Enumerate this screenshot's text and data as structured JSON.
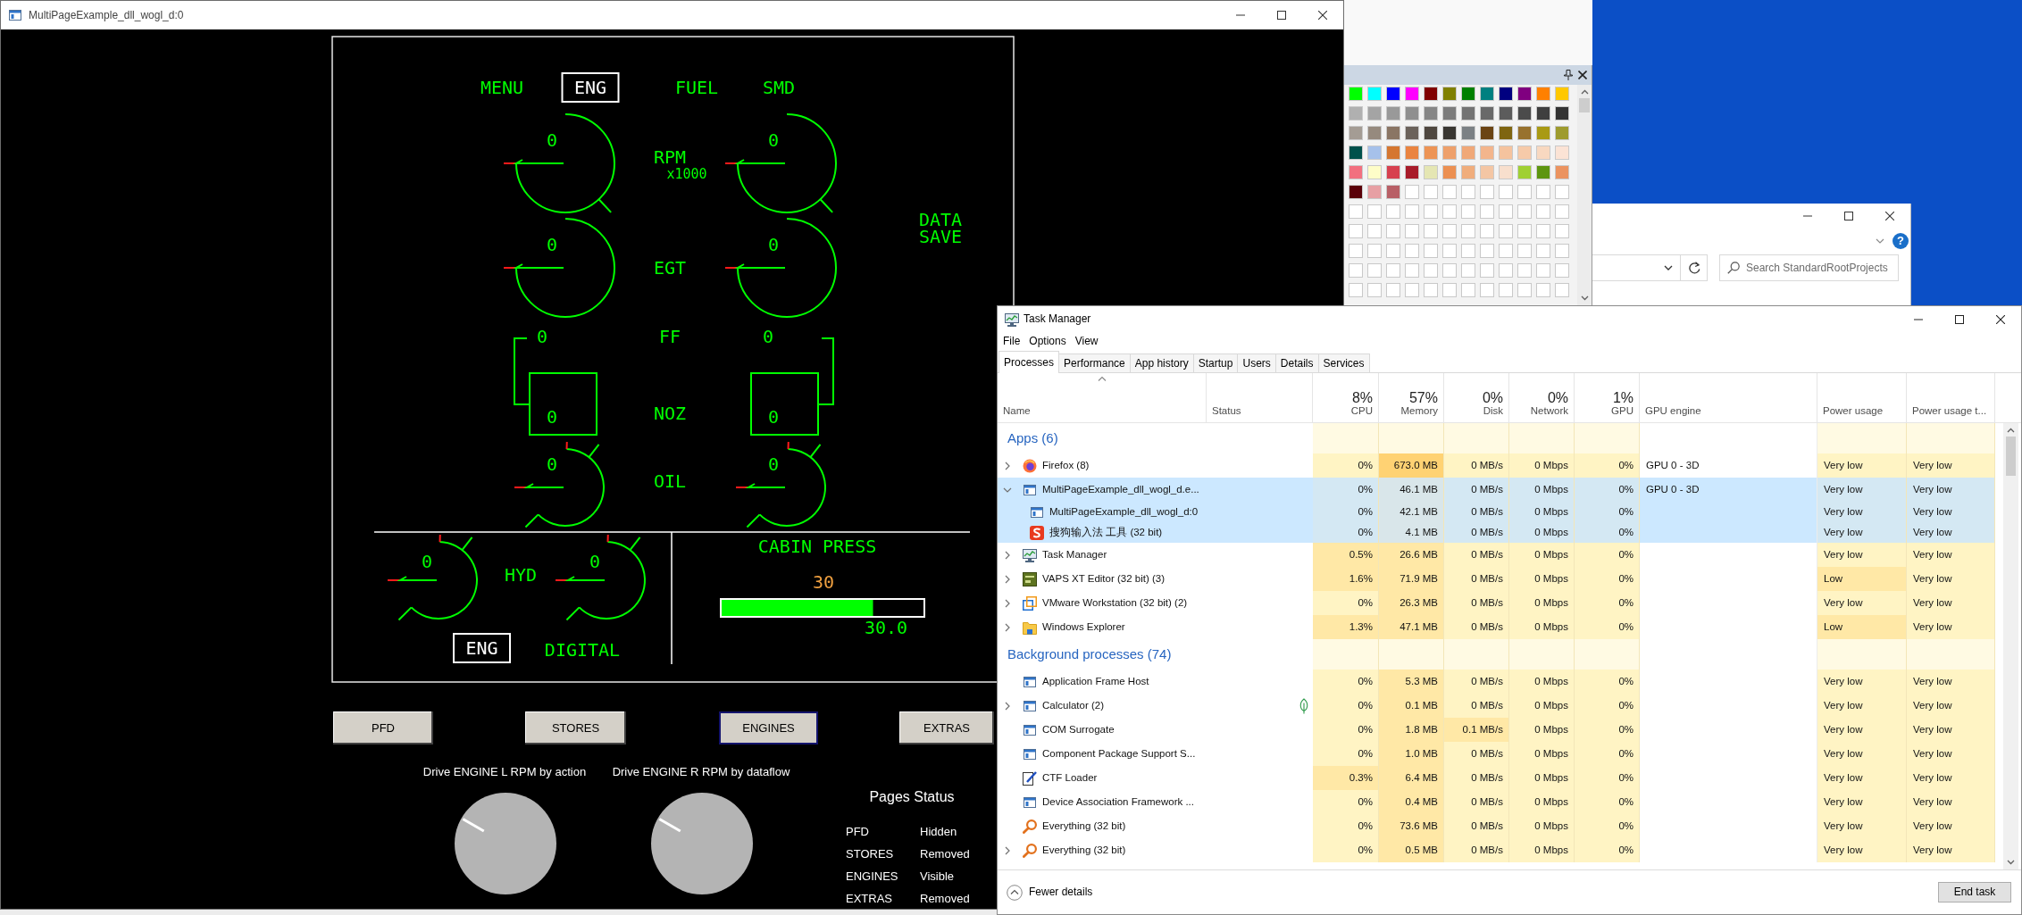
{
  "app_window": {
    "title": "MultiPageExample_dll_wogl_d:0",
    "engine_display": {
      "menu": [
        {
          "label": "MENU",
          "selected": false
        },
        {
          "label": "ENG",
          "selected": true
        },
        {
          "label": "FUEL",
          "selected": false
        },
        {
          "label": "SMD",
          "selected": false
        }
      ],
      "data_save": "DATA SAVE",
      "gauges": [
        {
          "kind": "dial",
          "label": "RPM",
          "sublabel": "x1000",
          "left": {
            "value": "0"
          },
          "right": {
            "value": "0"
          }
        },
        {
          "kind": "dial",
          "label": "EGT",
          "left": {
            "value": "0"
          },
          "right": {
            "value": "0"
          }
        },
        {
          "kind": "bracket",
          "label": "FF",
          "left": {
            "value": "0"
          },
          "right": {
            "value": "0"
          }
        },
        {
          "kind": "box",
          "label": "NOZ",
          "left": {
            "value": "0"
          },
          "right": {
            "value": "0"
          }
        },
        {
          "kind": "small_dial",
          "label": "OIL",
          "left": {
            "value": "0"
          },
          "right": {
            "value": "0"
          }
        }
      ],
      "hydraulics": {
        "label": "HYD",
        "left": {
          "value": "0"
        },
        "right": {
          "value": "0"
        }
      },
      "mode_button": "ENG",
      "mode_label": "DIGITAL",
      "cabin_press": {
        "title": "CABIN PRESS",
        "setpoint": "30",
        "level": 0.75,
        "reading": "30.0"
      }
    },
    "page_buttons": [
      {
        "label": "PFD",
        "selected": false
      },
      {
        "label": "STORES",
        "selected": false
      },
      {
        "label": "ENGINES",
        "selected": true
      },
      {
        "label": "EXTRAS",
        "selected": false
      }
    ],
    "knobs": [
      {
        "caption": "Drive ENGINE L RPM by action"
      },
      {
        "caption": "Drive ENGINE R RPM by dataflow"
      }
    ],
    "pages_status": {
      "title": "Pages Status",
      "rows": [
        {
          "page": "PFD",
          "status": "Hidden"
        },
        {
          "page": "STORES",
          "status": "Removed"
        },
        {
          "page": "ENGINES",
          "status": "Visible"
        },
        {
          "page": "EXTRAS",
          "status": "Removed"
        }
      ]
    }
  },
  "palette": {
    "swatches": [
      {
        "color": "#00ff00"
      },
      {
        "color": "#00ffff"
      },
      {
        "color": "#0000ff"
      },
      {
        "color": "#ff00ff"
      },
      {
        "color": "#800000"
      },
      {
        "color": "#808000"
      },
      {
        "color": "#008000"
      },
      {
        "color": "#008080"
      },
      {
        "color": "#000080"
      },
      {
        "color": "#800080"
      },
      {
        "color": "#ff8000"
      },
      {
        "color": "#ffc800"
      },
      {
        "color": "#b0b0b0"
      },
      {
        "color": "#a4a4a4"
      },
      {
        "color": "#999999"
      },
      {
        "color": "#8f8f8f"
      },
      {
        "color": "#868686"
      },
      {
        "color": "#7c7c7c"
      },
      {
        "color": "#737373"
      },
      {
        "color": "#696969"
      },
      {
        "color": "#5c5c5c"
      },
      {
        "color": "#4b4b4b"
      },
      {
        "color": "#3f3f3f"
      },
      {
        "color": "#333333"
      },
      {
        "color": "#a49c94"
      },
      {
        "color": "#968a7e"
      },
      {
        "color": "#8a7564"
      },
      {
        "color": "#6b625b"
      },
      {
        "color": "#4f4740"
      },
      {
        "color": "#393632"
      },
      {
        "color": "#7b8084"
      },
      {
        "color": "#6b4414"
      },
      {
        "color": "#7f6511"
      },
      {
        "color": "#98722e"
      },
      {
        "color": "#a99a14"
      },
      {
        "color": "#9e9b2e"
      },
      {
        "color": "#00514b"
      },
      {
        "color": "#a6c1ea"
      },
      {
        "color": "#d57630"
      },
      {
        "color": "#ea8441"
      },
      {
        "color": "#ed9455"
      },
      {
        "color": "#eea06b"
      },
      {
        "color": "#f0a878"
      },
      {
        "color": "#f3b58c"
      },
      {
        "color": "#f5c39e"
      },
      {
        "color": "#f6caa9"
      },
      {
        "color": "#f8d8c0"
      },
      {
        "color": "#fbe3d5"
      },
      {
        "color": "#f2707f"
      },
      {
        "color": "#fefdc8"
      },
      {
        "color": "#d7404f"
      },
      {
        "color": "#a81b29"
      },
      {
        "color": "#e5e6b3"
      },
      {
        "color": "#ec9052"
      },
      {
        "color": "#f0ad7c"
      },
      {
        "color": "#f4c6a4"
      },
      {
        "color": "#f8dfcd"
      },
      {
        "color": "#a0d033"
      },
      {
        "color": "#5d9510"
      },
      {
        "color": "#eb9360"
      },
      {
        "color": "#5a0008"
      },
      {
        "color": "#e7a0a4"
      },
      {
        "color": "#b85f66"
      },
      {
        "color": "#ffffff"
      },
      {
        "color": "#ffffff"
      },
      {
        "color": "#ffffff"
      },
      {
        "color": "#ffffff"
      },
      {
        "color": "#ffffff"
      },
      {
        "color": "#ffffff"
      },
      {
        "color": "#ffffff"
      },
      {
        "color": "#ffffff"
      },
      {
        "color": "#ffffff"
      },
      {
        "color": "#ffffff"
      },
      {
        "color": "#ffffff"
      },
      {
        "color": "#ffffff"
      },
      {
        "color": "#ffffff"
      },
      {
        "color": "#ffffff"
      },
      {
        "color": "#ffffff"
      },
      {
        "color": "#ffffff"
      },
      {
        "color": "#ffffff"
      },
      {
        "color": "#ffffff"
      },
      {
        "color": "#ffffff"
      },
      {
        "color": "#ffffff"
      },
      {
        "color": "#ffffff"
      },
      {
        "color": "#ffffff"
      },
      {
        "color": "#ffffff"
      },
      {
        "color": "#ffffff"
      },
      {
        "color": "#ffffff"
      },
      {
        "color": "#ffffff"
      },
      {
        "color": "#ffffff"
      },
      {
        "color": "#ffffff"
      },
      {
        "color": "#ffffff"
      },
      {
        "color": "#ffffff"
      },
      {
        "color": "#ffffff"
      },
      {
        "color": "#ffffff"
      },
      {
        "color": "#ffffff"
      },
      {
        "color": "#ffffff"
      },
      {
        "color": "#ffffff"
      },
      {
        "color": "#ffffff"
      },
      {
        "color": "#ffffff"
      },
      {
        "color": "#ffffff"
      },
      {
        "color": "#ffffff"
      },
      {
        "color": "#ffffff"
      },
      {
        "color": "#ffffff"
      },
      {
        "color": "#ffffff"
      },
      {
        "color": "#ffffff"
      },
      {
        "color": "#ffffff"
      },
      {
        "color": "#ffffff"
      },
      {
        "color": "#ffffff"
      },
      {
        "color": "#ffffff"
      },
      {
        "color": "#ffffff"
      },
      {
        "color": "#ffffff"
      },
      {
        "color": "#ffffff"
      },
      {
        "color": "#ffffff"
      },
      {
        "color": "#ffffff"
      },
      {
        "color": "#ffffff"
      },
      {
        "color": "#ffffff"
      },
      {
        "color": "#ffffff"
      },
      {
        "color": "#ffffff"
      },
      {
        "color": "#ffffff"
      },
      {
        "color": "#ffffff"
      },
      {
        "color": "#ffffff"
      },
      {
        "color": "#ffffff"
      },
      {
        "color": "#ffffff"
      },
      {
        "color": "#ffffff"
      },
      {
        "color": "#ffffff"
      },
      {
        "color": "#ffffff"
      },
      {
        "color": "#ffffff"
      },
      {
        "color": "#ffffff"
      },
      {
        "color": "#ffffff"
      },
      {
        "color": "#ffffff"
      },
      {
        "color": "#ffffff"
      }
    ]
  },
  "explorer": {
    "help_button": "?",
    "search": {
      "placeholder": "Search StandardRootProjects"
    }
  },
  "task_manager": {
    "title": "Task Manager",
    "menu": [
      "File",
      "Options",
      "View"
    ],
    "tabs": [
      {
        "label": "Processes",
        "selected": true
      },
      {
        "label": "Performance",
        "selected": false
      },
      {
        "label": "App history",
        "selected": false
      },
      {
        "label": "Startup",
        "selected": false
      },
      {
        "label": "Users",
        "selected": false
      },
      {
        "label": "Details",
        "selected": false
      },
      {
        "label": "Services",
        "selected": false
      }
    ],
    "columns": [
      {
        "label": "Name",
        "sorted": true
      },
      {
        "label": "Status",
        "sorted": false
      },
      {
        "label": "CPU",
        "usage": "8%",
        "sorted": false
      },
      {
        "label": "Memory",
        "usage": "57%",
        "sorted": false
      },
      {
        "label": "Disk",
        "usage": "0%",
        "sorted": false
      },
      {
        "label": "Network",
        "usage": "0%",
        "sorted": false
      },
      {
        "label": "GPU",
        "usage": "1%",
        "sorted": false
      },
      {
        "label": "GPU engine",
        "sorted": false
      },
      {
        "label": "Power usage",
        "sorted": false
      },
      {
        "label": "Power usage t...",
        "sorted": false
      }
    ],
    "rows": [
      {
        "kind": "group",
        "label": "Apps (6)"
      },
      {
        "kind": "process",
        "name": "Firefox (8)",
        "selected": false,
        "expanded": false,
        "suspended": false,
        "cells": {
          "cpu": {
            "text": "0%",
            "color": "#fff4c4"
          },
          "memory": {
            "text": "673.0 MB",
            "color": "#ffd273"
          },
          "disk": {
            "text": "0 MB/s",
            "color": "#fff4c4"
          },
          "network": {
            "text": "0 Mbps",
            "color": "#fff4c4"
          },
          "gpu": {
            "text": "0%",
            "color": "#fff4c4"
          },
          "gpu_engine": {
            "text": "GPU 0 - 3D"
          },
          "power": {
            "text": "Very low",
            "color": "#fff4c4"
          },
          "power_trend": {
            "text": "Very low",
            "color": "#fff4c4"
          }
        }
      },
      {
        "kind": "process",
        "name": "MultiPageExample_dll_wogl_d.e...",
        "selected": true,
        "expanded": true,
        "suspended": false,
        "cells": {
          "cpu": {
            "text": "0%",
            "color": "#d4e8f3"
          },
          "memory": {
            "text": "46.1 MB",
            "color": "#d9e6ea"
          },
          "disk": {
            "text": "0 MB/s",
            "color": "#d4e8f3"
          },
          "network": {
            "text": "0 Mbps",
            "color": "#d4e8f3"
          },
          "gpu": {
            "text": "0%",
            "color": "#d4e8f3"
          },
          "gpu_engine": {
            "text": "GPU 0 - 3D"
          },
          "power": {
            "text": "Very low",
            "color": "#d4e8f3"
          },
          "power_trend": {
            "text": "Very low",
            "color": "#d4e8f3"
          }
        },
        "children": [
          {
            "name": "MultiPageExample_dll_wogl_d:0",
            "selected": true,
            "suspended": false,
            "cells": {
              "cpu": {
                "text": "0%",
                "color": "#d4e8f3"
              },
              "memory": {
                "text": "42.1 MB",
                "color": "#d9e6ea"
              },
              "disk": {
                "text": "0 MB/s",
                "color": "#d4e8f3"
              },
              "network": {
                "text": "0 Mbps",
                "color": "#d4e8f3"
              },
              "gpu": {
                "text": "0%",
                "color": "#d4e8f3"
              },
              "power": {
                "text": "Very low",
                "color": "#d4e8f3"
              },
              "power_trend": {
                "text": "Very low",
                "color": "#d4e8f3"
              }
            }
          },
          {
            "name": "搜狗输入法 工具 (32 bit)",
            "selected": true,
            "suspended": false,
            "cells": {
              "cpu": {
                "text": "0%",
                "color": "#d4e8f3"
              },
              "memory": {
                "text": "4.1 MB",
                "color": "#d9e6ea"
              },
              "disk": {
                "text": "0 MB/s",
                "color": "#d4e8f3"
              },
              "network": {
                "text": "0 Mbps",
                "color": "#d4e8f3"
              },
              "gpu": {
                "text": "0%",
                "color": "#d4e8f3"
              },
              "power": {
                "text": "Very low",
                "color": "#d4e8f3"
              },
              "power_trend": {
                "text": "Very low",
                "color": "#d4e8f3"
              }
            }
          }
        ]
      },
      {
        "kind": "process",
        "name": "Task Manager",
        "selected": false,
        "expanded": false,
        "suspended": false,
        "cells": {
          "cpu": {
            "text": "0.5%",
            "color": "#ffe8a6"
          },
          "memory": {
            "text": "26.6 MB",
            "color": "#ffe8a6"
          },
          "disk": {
            "text": "0 MB/s",
            "color": "#fff4c4"
          },
          "network": {
            "text": "0 Mbps",
            "color": "#fff4c4"
          },
          "gpu": {
            "text": "0%",
            "color": "#fff4c4"
          },
          "power": {
            "text": "Very low",
            "color": "#fff4c4"
          },
          "power_trend": {
            "text": "Very low",
            "color": "#fff4c4"
          }
        }
      },
      {
        "kind": "process",
        "name": "VAPS XT Editor (32 bit) (3)",
        "selected": false,
        "expanded": false,
        "suspended": false,
        "cells": {
          "cpu": {
            "text": "1.6%",
            "color": "#ffe8a6"
          },
          "memory": {
            "text": "71.9 MB",
            "color": "#ffe8a6"
          },
          "disk": {
            "text": "0 MB/s",
            "color": "#fff4c4"
          },
          "network": {
            "text": "0 Mbps",
            "color": "#fff4c4"
          },
          "gpu": {
            "text": "0%",
            "color": "#fff4c4"
          },
          "power": {
            "text": "Low",
            "color": "#ffe8a6"
          },
          "power_trend": {
            "text": "Very low",
            "color": "#fff4c4"
          }
        }
      },
      {
        "kind": "process",
        "name": "VMware Workstation (32 bit) (2)",
        "selected": false,
        "expanded": false,
        "suspended": false,
        "cells": {
          "cpu": {
            "text": "0%",
            "color": "#fff4c4"
          },
          "memory": {
            "text": "26.3 MB",
            "color": "#ffe8a6"
          },
          "disk": {
            "text": "0 MB/s",
            "color": "#fff4c4"
          },
          "network": {
            "text": "0 Mbps",
            "color": "#fff4c4"
          },
          "gpu": {
            "text": "0%",
            "color": "#fff4c4"
          },
          "power": {
            "text": "Very low",
            "color": "#fff4c4"
          },
          "power_trend": {
            "text": "Very low",
            "color": "#fff4c4"
          }
        }
      },
      {
        "kind": "process",
        "name": "Windows Explorer",
        "selected": false,
        "expanded": false,
        "suspended": false,
        "cells": {
          "cpu": {
            "text": "1.3%",
            "color": "#ffe8a6"
          },
          "memory": {
            "text": "47.1 MB",
            "color": "#ffe8a6"
          },
          "disk": {
            "text": "0 MB/s",
            "color": "#fff4c4"
          },
          "network": {
            "text": "0 Mbps",
            "color": "#fff4c4"
          },
          "gpu": {
            "text": "0%",
            "color": "#fff4c4"
          },
          "power": {
            "text": "Low",
            "color": "#ffe8a6"
          },
          "power_trend": {
            "text": "Very low",
            "color": "#fff4c4"
          }
        }
      },
      {
        "kind": "group",
        "label": "Background processes (74)"
      },
      {
        "kind": "process",
        "name": "Application Frame Host",
        "selected": false,
        "suspended": false,
        "cells": {
          "cpu": {
            "text": "0%",
            "color": "#fff4c4"
          },
          "memory": {
            "text": "5.3 MB",
            "color": "#ffe8a6"
          },
          "disk": {
            "text": "0 MB/s",
            "color": "#fff4c4"
          },
          "network": {
            "text": "0 Mbps",
            "color": "#fff4c4"
          },
          "gpu": {
            "text": "0%",
            "color": "#fff4c4"
          },
          "power": {
            "text": "Very low",
            "color": "#fff4c4"
          },
          "power_trend": {
            "text": "Very low",
            "color": "#fff4c4"
          }
        }
      },
      {
        "kind": "process",
        "name": "Calculator (2)",
        "selected": false,
        "expanded": false,
        "suspended": true,
        "cells": {
          "cpu": {
            "text": "0%",
            "color": "#fff4c4"
          },
          "memory": {
            "text": "0.1 MB",
            "color": "#ffe8a6"
          },
          "disk": {
            "text": "0 MB/s",
            "color": "#fff4c4"
          },
          "network": {
            "text": "0 Mbps",
            "color": "#fff4c4"
          },
          "gpu": {
            "text": "0%",
            "color": "#fff4c4"
          },
          "power": {
            "text": "Very low",
            "color": "#fff4c4"
          },
          "power_trend": {
            "text": "Very low",
            "color": "#fff4c4"
          }
        }
      },
      {
        "kind": "process",
        "name": "COM Surrogate",
        "selected": false,
        "suspended": false,
        "cells": {
          "cpu": {
            "text": "0%",
            "color": "#fff4c4"
          },
          "memory": {
            "text": "1.8 MB",
            "color": "#ffe8a6"
          },
          "disk": {
            "text": "0.1 MB/s",
            "color": "#ffe8a6"
          },
          "network": {
            "text": "0 Mbps",
            "color": "#fff4c4"
          },
          "gpu": {
            "text": "0%",
            "color": "#fff4c4"
          },
          "power": {
            "text": "Very low",
            "color": "#fff4c4"
          },
          "power_trend": {
            "text": "Very low",
            "color": "#fff4c4"
          }
        }
      },
      {
        "kind": "process",
        "name": "Component Package Support S...",
        "selected": false,
        "suspended": false,
        "cells": {
          "cpu": {
            "text": "0%",
            "color": "#fff4c4"
          },
          "memory": {
            "text": "1.0 MB",
            "color": "#ffe8a6"
          },
          "disk": {
            "text": "0 MB/s",
            "color": "#fff4c4"
          },
          "network": {
            "text": "0 Mbps",
            "color": "#fff4c4"
          },
          "gpu": {
            "text": "0%",
            "color": "#fff4c4"
          },
          "power": {
            "text": "Very low",
            "color": "#fff4c4"
          },
          "power_trend": {
            "text": "Very low",
            "color": "#fff4c4"
          }
        }
      },
      {
        "kind": "process",
        "name": "CTF Loader",
        "selected": false,
        "suspended": false,
        "cells": {
          "cpu": {
            "text": "0.3%",
            "color": "#ffe8a6"
          },
          "memory": {
            "text": "6.4 MB",
            "color": "#ffe8a6"
          },
          "disk": {
            "text": "0 MB/s",
            "color": "#fff4c4"
          },
          "network": {
            "text": "0 Mbps",
            "color": "#fff4c4"
          },
          "gpu": {
            "text": "0%",
            "color": "#fff4c4"
          },
          "power": {
            "text": "Very low",
            "color": "#fff4c4"
          },
          "power_trend": {
            "text": "Very low",
            "color": "#fff4c4"
          }
        }
      },
      {
        "kind": "process",
        "name": "Device Association Framework ...",
        "selected": false,
        "suspended": false,
        "cells": {
          "cpu": {
            "text": "0%",
            "color": "#fff4c4"
          },
          "memory": {
            "text": "0.4 MB",
            "color": "#ffe8a6"
          },
          "disk": {
            "text": "0 MB/s",
            "color": "#fff4c4"
          },
          "network": {
            "text": "0 Mbps",
            "color": "#fff4c4"
          },
          "gpu": {
            "text": "0%",
            "color": "#fff4c4"
          },
          "power": {
            "text": "Very low",
            "color": "#fff4c4"
          },
          "power_trend": {
            "text": "Very low",
            "color": "#fff4c4"
          }
        }
      },
      {
        "kind": "process",
        "name": "Everything (32 bit)",
        "selected": false,
        "suspended": false,
        "cells": {
          "cpu": {
            "text": "0%",
            "color": "#fff4c4"
          },
          "memory": {
            "text": "73.6 MB",
            "color": "#ffe8a6"
          },
          "disk": {
            "text": "0 MB/s",
            "color": "#fff4c4"
          },
          "network": {
            "text": "0 Mbps",
            "color": "#fff4c4"
          },
          "gpu": {
            "text": "0%",
            "color": "#fff4c4"
          },
          "power": {
            "text": "Very low",
            "color": "#fff4c4"
          },
          "power_trend": {
            "text": "Very low",
            "color": "#fff4c4"
          }
        }
      },
      {
        "kind": "process",
        "name": "Everything (32 bit)",
        "selected": false,
        "expanded": false,
        "suspended": false,
        "cells": {
          "cpu": {
            "text": "0%",
            "color": "#fff4c4"
          },
          "memory": {
            "text": "0.5 MB",
            "color": "#ffe8a6"
          },
          "disk": {
            "text": "0 MB/s",
            "color": "#fff4c4"
          },
          "network": {
            "text": "0 Mbps",
            "color": "#fff4c4"
          },
          "gpu": {
            "text": "0%",
            "color": "#fff4c4"
          },
          "power": {
            "text": "Very low",
            "color": "#fff4c4"
          },
          "power_trend": {
            "text": "Very low",
            "color": "#fff4c4"
          }
        }
      }
    ],
    "footer": {
      "toggle": "Fewer details",
      "end_task": "End task"
    }
  }
}
